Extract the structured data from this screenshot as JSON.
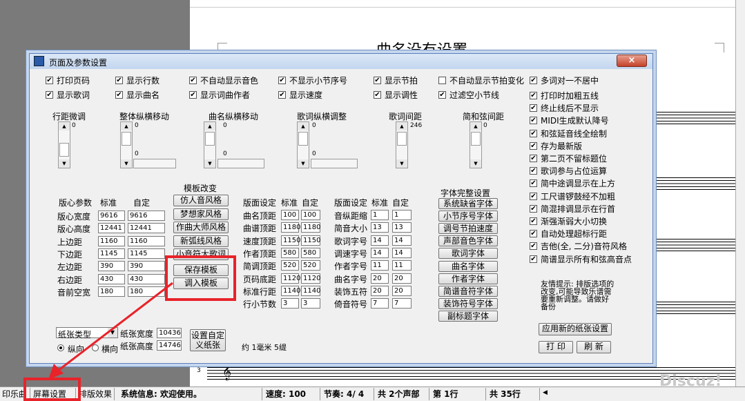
{
  "document": {
    "song_title": "曲名没有设置",
    "measure_num": "3",
    "clef_glyph": "𝄞"
  },
  "dialog": {
    "title": "页面及参数设置",
    "close_glyph": "×",
    "checkboxes_row1": [
      {
        "label": "打印页码",
        "checked": true
      },
      {
        "label": "显示行数",
        "checked": true
      },
      {
        "label": "不自动显示音色",
        "checked": true
      },
      {
        "label": "不显示小节序号",
        "checked": true
      },
      {
        "label": "显示节拍",
        "checked": true
      },
      {
        "label": "不自动显示节拍变化",
        "checked": false
      },
      {
        "label": "多词对一不居中",
        "checked": true
      }
    ],
    "checkboxes_row2": [
      {
        "label": "显示歌词",
        "checked": true
      },
      {
        "label": "显示曲名",
        "checked": true
      },
      {
        "label": "显示词曲作者",
        "checked": true
      },
      {
        "label": "显示速度",
        "checked": true
      },
      {
        "label": "显示调性",
        "checked": true
      },
      {
        "label": "过滤空小节线",
        "checked": true
      }
    ],
    "checkboxes_right": [
      {
        "label": "打印时加粗五线",
        "checked": true
      },
      {
        "label": "终止线后不显示",
        "checked": true
      },
      {
        "label": "MIDI生成默认降号",
        "checked": true
      },
      {
        "label": "和弦延音线全绘制",
        "checked": true
      },
      {
        "label": "存为最新版",
        "checked": true
      },
      {
        "label": "第二页不留标题位",
        "checked": true
      },
      {
        "label": "歌词参与占位运算",
        "checked": true
      },
      {
        "label": "简中途调显示在上方",
        "checked": true
      },
      {
        "label": "工尺谱锣鼓经不加粗",
        "checked": true
      },
      {
        "label": "简混排调显示在行首",
        "checked": true
      },
      {
        "label": "渐强渐弱大小切换",
        "checked": true
      },
      {
        "label": "自动处理超标行距",
        "checked": true
      },
      {
        "label": "吉他(全, 二分)音符风格",
        "checked": true
      },
      {
        "label": "简谱显示所有和弦高音点",
        "checked": true
      }
    ],
    "scroll_groups": {
      "line_spacing": {
        "label": "行距微调",
        "value": "0"
      },
      "whole_move": {
        "label": "整体纵横移动",
        "v_value": "0",
        "h_value": "0"
      },
      "title_move": {
        "label": "曲名纵横移动",
        "v_value": "0",
        "h_value": "0"
      },
      "lyric_adjust": {
        "label": "歌词纵横调整",
        "v_value": "0",
        "h_value": "0"
      },
      "lyric_spacing": {
        "label": "歌词间距",
        "value": "246"
      },
      "chord_spacing": {
        "label": "简和弦间距",
        "value": "0"
      }
    },
    "layout_params": {
      "header": {
        "title": "版心参数",
        "std": "标准",
        "custom": "自定"
      },
      "rows": [
        {
          "label": "版心宽度",
          "std": "9616",
          "custom": "9616"
        },
        {
          "label": "版心高度",
          "std": "12441",
          "custom": "12441"
        },
        {
          "label": "上边距",
          "std": "1160",
          "custom": "1160"
        },
        {
          "label": "下边距",
          "std": "1145",
          "custom": "1145"
        },
        {
          "label": "左边距",
          "std": "390",
          "custom": "390"
        },
        {
          "label": "右边距",
          "std": "430",
          "custom": "430"
        },
        {
          "label": "音前空宽",
          "std": "180",
          "custom": "180"
        }
      ]
    },
    "template": {
      "title": "模板改变",
      "buttons": [
        "仿人音风格",
        "梦想家风格",
        "作曲大师风格",
        "新弧线风格",
        "小音符大歌词"
      ],
      "save_button": "保存模板",
      "load_button": "调入模板"
    },
    "page_settings": {
      "header": {
        "title": "版面设定",
        "std": "标准",
        "custom": "自定"
      },
      "rows": [
        {
          "label": "曲名顶距",
          "std": "100",
          "custom": "100"
        },
        {
          "label": "曲谱顶距",
          "std": "1180",
          "custom": "1180"
        },
        {
          "label": "速度顶距",
          "std": "1150",
          "custom": "1150"
        },
        {
          "label": "作者顶距",
          "std": "580",
          "custom": "580"
        },
        {
          "label": "简调顶距",
          "std": "520",
          "custom": "520"
        },
        {
          "label": "页码底距",
          "std": "1120",
          "custom": "1120"
        },
        {
          "label": "标准行距",
          "std": "1140",
          "custom": "1140"
        },
        {
          "label": "行小节数",
          "std": "3",
          "custom": "3"
        }
      ]
    },
    "page_settings2": {
      "header": {
        "title": "版面设定",
        "std": "标准",
        "custom": "自定"
      },
      "rows": [
        {
          "label": "音纵距缩",
          "std": "1",
          "custom": "1"
        },
        {
          "label": "简音大小",
          "std": "13",
          "custom": "13"
        },
        {
          "label": "歌词字号",
          "std": "14",
          "custom": "14"
        },
        {
          "label": "调速字号",
          "std": "14",
          "custom": "14"
        },
        {
          "label": "作者字号",
          "std": "11",
          "custom": "11"
        },
        {
          "label": "曲名字号",
          "std": "20",
          "custom": "20"
        },
        {
          "label": "装饰五符",
          "std": "20",
          "custom": "20"
        },
        {
          "label": "倚音符号",
          "std": "7",
          "custom": "7"
        }
      ]
    },
    "fonts": {
      "title": "字体完整设置",
      "buttons": [
        "系统缺省字体",
        "小节序号字体",
        "调号节拍速度",
        "声部音色字体",
        "歌词字体",
        "曲名字体",
        "作者字体",
        "简谱音符字体",
        "装饰符号字体",
        "副标题字体"
      ]
    },
    "tip": "友情提示: 排版选项的改变,可能导致乐谱需要重新调整。请做好备份",
    "apply_paper_button": "应用新的纸张设置",
    "print_button": "打 印",
    "refresh_button": "刷 新",
    "paper": {
      "type_label": "纸张类型",
      "width_label": "纸张宽度",
      "width_value": "10436",
      "height_label": "纸张高度",
      "height_value": "14746",
      "portrait_label": "纵向",
      "landscape_label": "横向",
      "custom_button": "设置自定义纸张",
      "conversion": "约 1毫米 5缇"
    }
  },
  "statusbar": {
    "tab_print": "印乐曲",
    "tab_screen": "屏幕设置",
    "tab_layout": "排版效果",
    "sys_info": "系统信息: 欢迎使用。",
    "speed": "速度: 100",
    "beat": "节奏: 4/ 4",
    "voices": "共 2个声部",
    "line": "第 1行",
    "total_lines": "共 35行"
  },
  "watermark": "Discuz!",
  "colors": {
    "highlight_red": "#e8232a",
    "title_bar": "#c3d6ef"
  }
}
